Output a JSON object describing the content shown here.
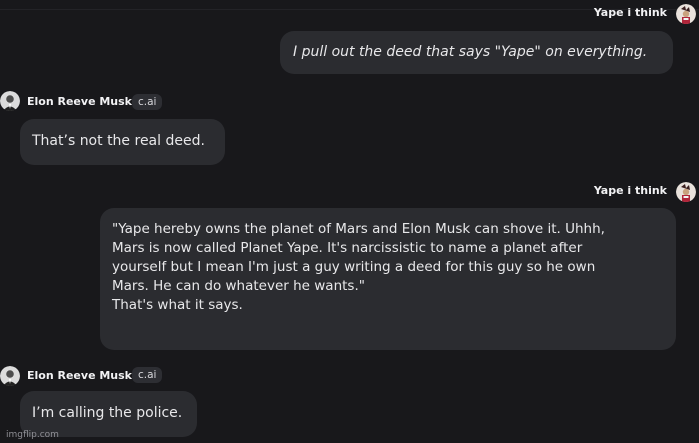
{
  "user": {
    "name": "Yape i think"
  },
  "character": {
    "name": "Elon Reeve Musk",
    "badge": "c.ai"
  },
  "messages": [
    {
      "lines": [
        "I pull out the deed that says \"Yape\" on everything."
      ]
    },
    {
      "lines": [
        "That’s not the real deed."
      ]
    },
    {
      "lines": [
        "\"Yape hereby owns the planet of Mars and Elon Musk can shove it. Uhhh,",
        "Mars is now called Planet Yape. It's narcissistic to name a planet after",
        "yourself but I mean I'm just a guy writing a deed for this guy so he own",
        "Mars. He can do whatever he wants.\"",
        "That's what it says."
      ]
    },
    {
      "lines": [
        "I’m calling the police."
      ]
    }
  ],
  "watermark": "imgflip.com",
  "colors": {
    "background": "#18181b",
    "bubble": "#2b2c30",
    "badge": "#2d2e33"
  },
  "icons": [
    "user-avatar-icon",
    "character-avatar-icon"
  ]
}
